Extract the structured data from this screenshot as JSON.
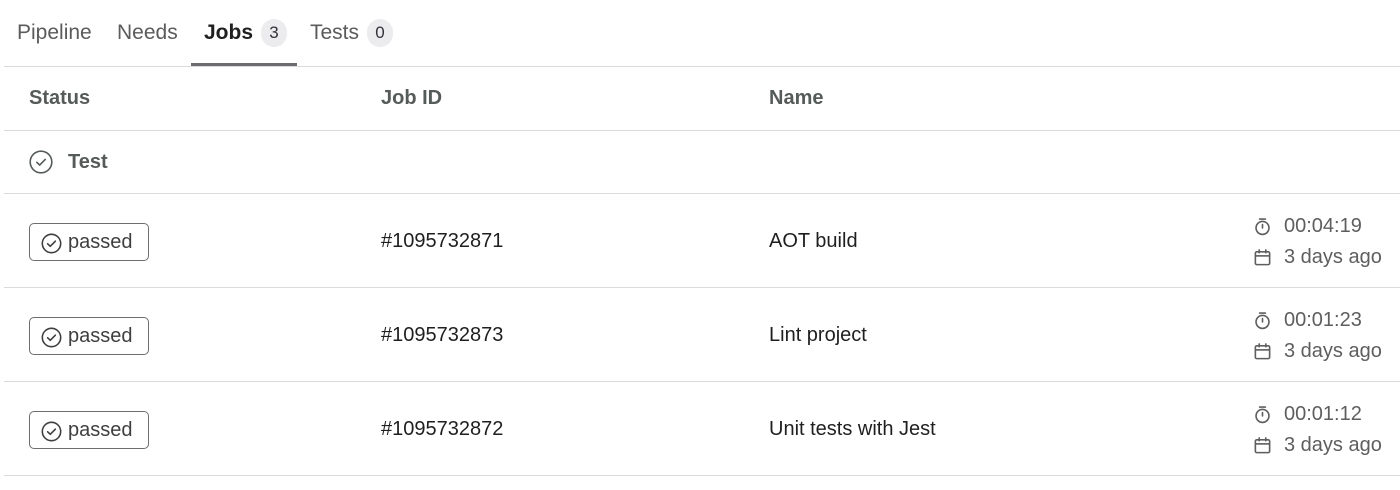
{
  "tabs": [
    {
      "label": "Pipeline",
      "active": false
    },
    {
      "label": "Needs",
      "active": false
    },
    {
      "label": "Jobs",
      "badge": "3",
      "active": true
    },
    {
      "label": "Tests",
      "badge": "0",
      "active": false
    }
  ],
  "table": {
    "columns": {
      "status": "Status",
      "job_id": "Job ID",
      "name": "Name"
    },
    "stage": {
      "name": "Test",
      "icon": "check-circle-icon"
    },
    "jobs": [
      {
        "status": "passed",
        "job_id": "#1095732871",
        "name": "AOT build",
        "duration": "00:04:19",
        "finished": "3 days ago"
      },
      {
        "status": "passed",
        "job_id": "#1095732873",
        "name": "Lint project",
        "duration": "00:01:23",
        "finished": "3 days ago"
      },
      {
        "status": "passed",
        "job_id": "#1095732872",
        "name": "Unit tests with Jest",
        "duration": "00:01:12",
        "finished": "3 days ago"
      }
    ]
  },
  "icons": {
    "status": "check-circle-icon",
    "duration": "timer-icon",
    "finished": "calendar-icon"
  },
  "colors": {
    "text_primary": "#1f1f1f",
    "text_secondary": "#5e5e5e",
    "border": "#dbdbdb",
    "active_tab_underline": "#6b6b70",
    "badge_bg": "#ececef"
  }
}
